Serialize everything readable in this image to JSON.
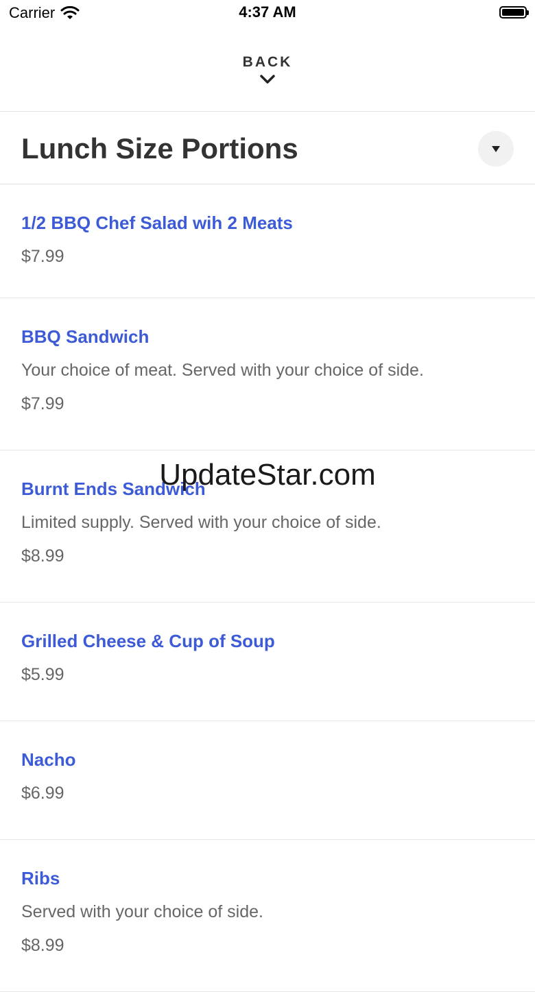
{
  "status_bar": {
    "carrier": "Carrier",
    "time": "4:37 AM"
  },
  "nav": {
    "back_label": "BACK"
  },
  "section": {
    "title": "Lunch Size Portions"
  },
  "items": [
    {
      "name": "1/2 BBQ Chef Salad wih 2 Meats",
      "description": "",
      "price": "$7.99"
    },
    {
      "name": "BBQ Sandwich",
      "description": "Your choice of meat. Served with your choice of side.",
      "price": "$7.99"
    },
    {
      "name": "Burnt Ends Sandwich",
      "description": "Limited supply. Served with your choice of side.",
      "price": "$8.99"
    },
    {
      "name": "Grilled Cheese & Cup of Soup",
      "description": "",
      "price": "$5.99"
    },
    {
      "name": "Nacho",
      "description": "",
      "price": "$6.99"
    },
    {
      "name": "Ribs",
      "description": "Served with your choice of side.",
      "price": "$8.99"
    }
  ],
  "watermark": "UpdateStar.com",
  "colors": {
    "accent": "#3d5bd6",
    "text": "#333333",
    "muted": "#666666"
  }
}
